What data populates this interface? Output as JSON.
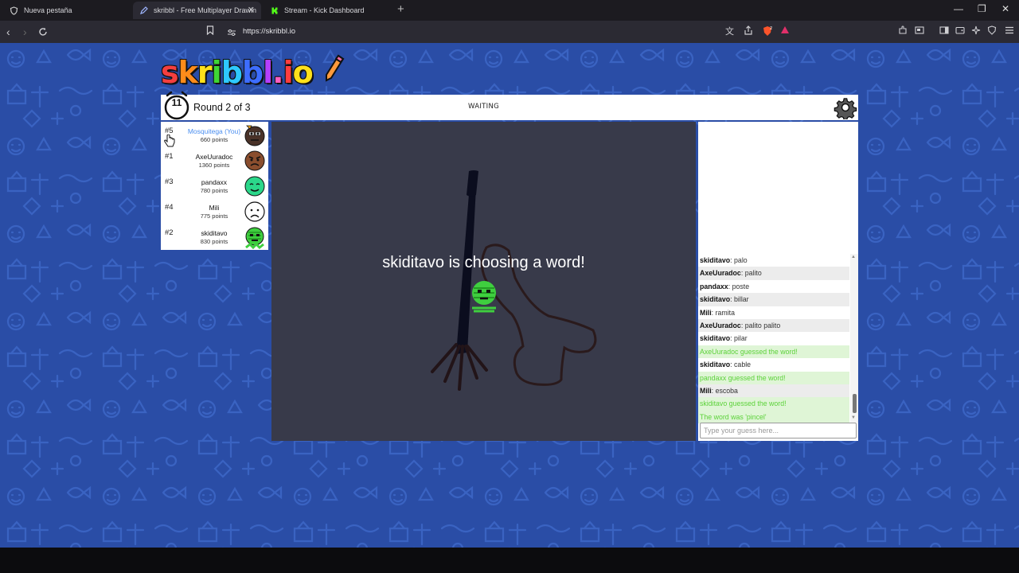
{
  "browser": {
    "tabs": [
      {
        "title": "Nueva pestaña",
        "active": false
      },
      {
        "title": "skribbl - Free Multiplayer Drawin",
        "active": true
      },
      {
        "title": "Stream - Kick Dashboard",
        "active": false
      }
    ],
    "new_tab": "+",
    "url": "https://skribbl.io",
    "controls": {
      "minimize": "—",
      "restore": "❐",
      "close": "✕"
    }
  },
  "game": {
    "logo": {
      "letters": [
        "s",
        "k",
        "r",
        "i",
        "b",
        "b",
        "l",
        ".",
        "i",
        "o"
      ],
      "colors": [
        "#f33f3f",
        "#ff8c1a",
        "#ffe11a",
        "#3fd635",
        "#2ec9ff",
        "#3d6dff",
        "#b43fff",
        "#ff5ec0",
        "#ff3d3d",
        "#ffe11a"
      ]
    },
    "timer": "11",
    "round_label": "Round 2 of 3",
    "status": "WAITING",
    "players": [
      {
        "rank": "#5",
        "name": "Mosquitega (You)",
        "points": "660 points",
        "you": true,
        "avatar_color": "#6b4a3a"
      },
      {
        "rank": "#1",
        "name": "AxeUuradoc",
        "points": "1360 points",
        "you": false,
        "avatar_color": "#7a4a30"
      },
      {
        "rank": "#3",
        "name": "pandaxx",
        "points": "780 points",
        "you": false,
        "avatar_color": "#2bd78a"
      },
      {
        "rank": "#4",
        "name": "Mili",
        "points": "775 points",
        "you": false,
        "avatar_color": "#ffffff"
      },
      {
        "rank": "#2",
        "name": "skiditavo",
        "points": "830 points",
        "you": false,
        "avatar_color": "#3fcf3f"
      }
    ],
    "canvas_message": "skiditavo is choosing a word!",
    "chat": [
      {
        "user": "skiditavo",
        "text": "palo",
        "type": "normal"
      },
      {
        "user": "AxeUuradoc",
        "text": "palito",
        "type": "normal"
      },
      {
        "user": "pandaxx",
        "text": "poste",
        "type": "normal"
      },
      {
        "user": "skiditavo",
        "text": "billar",
        "type": "normal"
      },
      {
        "user": "Mili",
        "text": "ramita",
        "type": "normal"
      },
      {
        "user": "AxeUuradoc",
        "text": "palito palito",
        "type": "normal"
      },
      {
        "user": "skiditavo",
        "text": "pilar",
        "type": "normal"
      },
      {
        "user": "",
        "text": "AxeUuradoc guessed the word!",
        "type": "good"
      },
      {
        "user": "skiditavo",
        "text": "cable",
        "type": "normal"
      },
      {
        "user": "",
        "text": "pandaxx guessed the word!",
        "type": "good"
      },
      {
        "user": "Mili",
        "text": "escoba",
        "type": "normal"
      },
      {
        "user": "",
        "text": "skiditavo guessed the word!",
        "type": "good"
      },
      {
        "user": "",
        "text": "The word was 'pincel'",
        "type": "good"
      }
    ],
    "guess_placeholder": "Type your guess here...",
    "colors": {
      "background": "#2a4da6",
      "canvas": "#383a4a",
      "guessed": "#5cd23a",
      "you": "#4a8ef0"
    }
  }
}
